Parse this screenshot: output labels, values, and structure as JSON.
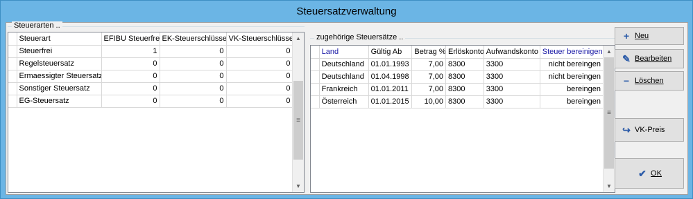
{
  "window": {
    "title": "Steuersatzverwaltung"
  },
  "left_group": {
    "label": "Steuerarten ..",
    "columns": [
      "Steuerart",
      "EFIBU Steuerfrei",
      "EK-Steuerschlüssel",
      "VK-Steuerschlüssel"
    ],
    "rows": [
      [
        "Steuerfrei",
        "1",
        "0",
        "0"
      ],
      [
        "Regelsteuersatz",
        "0",
        "0",
        "0"
      ],
      [
        "Ermaessigter Steuersatz",
        "0",
        "0",
        "0"
      ],
      [
        "Sonstiger Steuersatz",
        "0",
        "0",
        "0"
      ],
      [
        "EG-Steuersatz",
        "0",
        "0",
        "0"
      ]
    ]
  },
  "right_group": {
    "label": "zugehörige Steuersätze ..",
    "columns": [
      "Land",
      "Gültig Ab",
      "Betrag %",
      "Erlöskonto",
      "Aufwandskonto",
      "Steuer bereinigen"
    ],
    "rows": [
      [
        "Deutschland",
        "01.01.1993",
        "7,00",
        "8300",
        "3300",
        "nicht bereingen"
      ],
      [
        "Deutschland",
        "01.04.1998",
        "7,00",
        "8300",
        "3300",
        "nicht bereingen"
      ],
      [
        "Frankreich",
        "01.01.2011",
        "7,00",
        "8300",
        "3300",
        "bereingen"
      ],
      [
        "Österreich",
        "01.01.2015",
        "10,00",
        "8300",
        "3300",
        "bereingen"
      ]
    ]
  },
  "buttons": {
    "neu": "Neu",
    "bearbeiten": "Bearbeiten",
    "loeschen": "Löschen",
    "vkpreis": "VK-Preis",
    "ok": "OK"
  },
  "icons": {
    "neu": "plus-icon",
    "bearbeiten": "pencil-icon",
    "loeschen": "minus-icon",
    "vkpreis": "price-icon",
    "ok": "checkmark-icon"
  },
  "colors": {
    "titlebar": "#6bb5e5",
    "header_blue": "#1a1aa6"
  }
}
